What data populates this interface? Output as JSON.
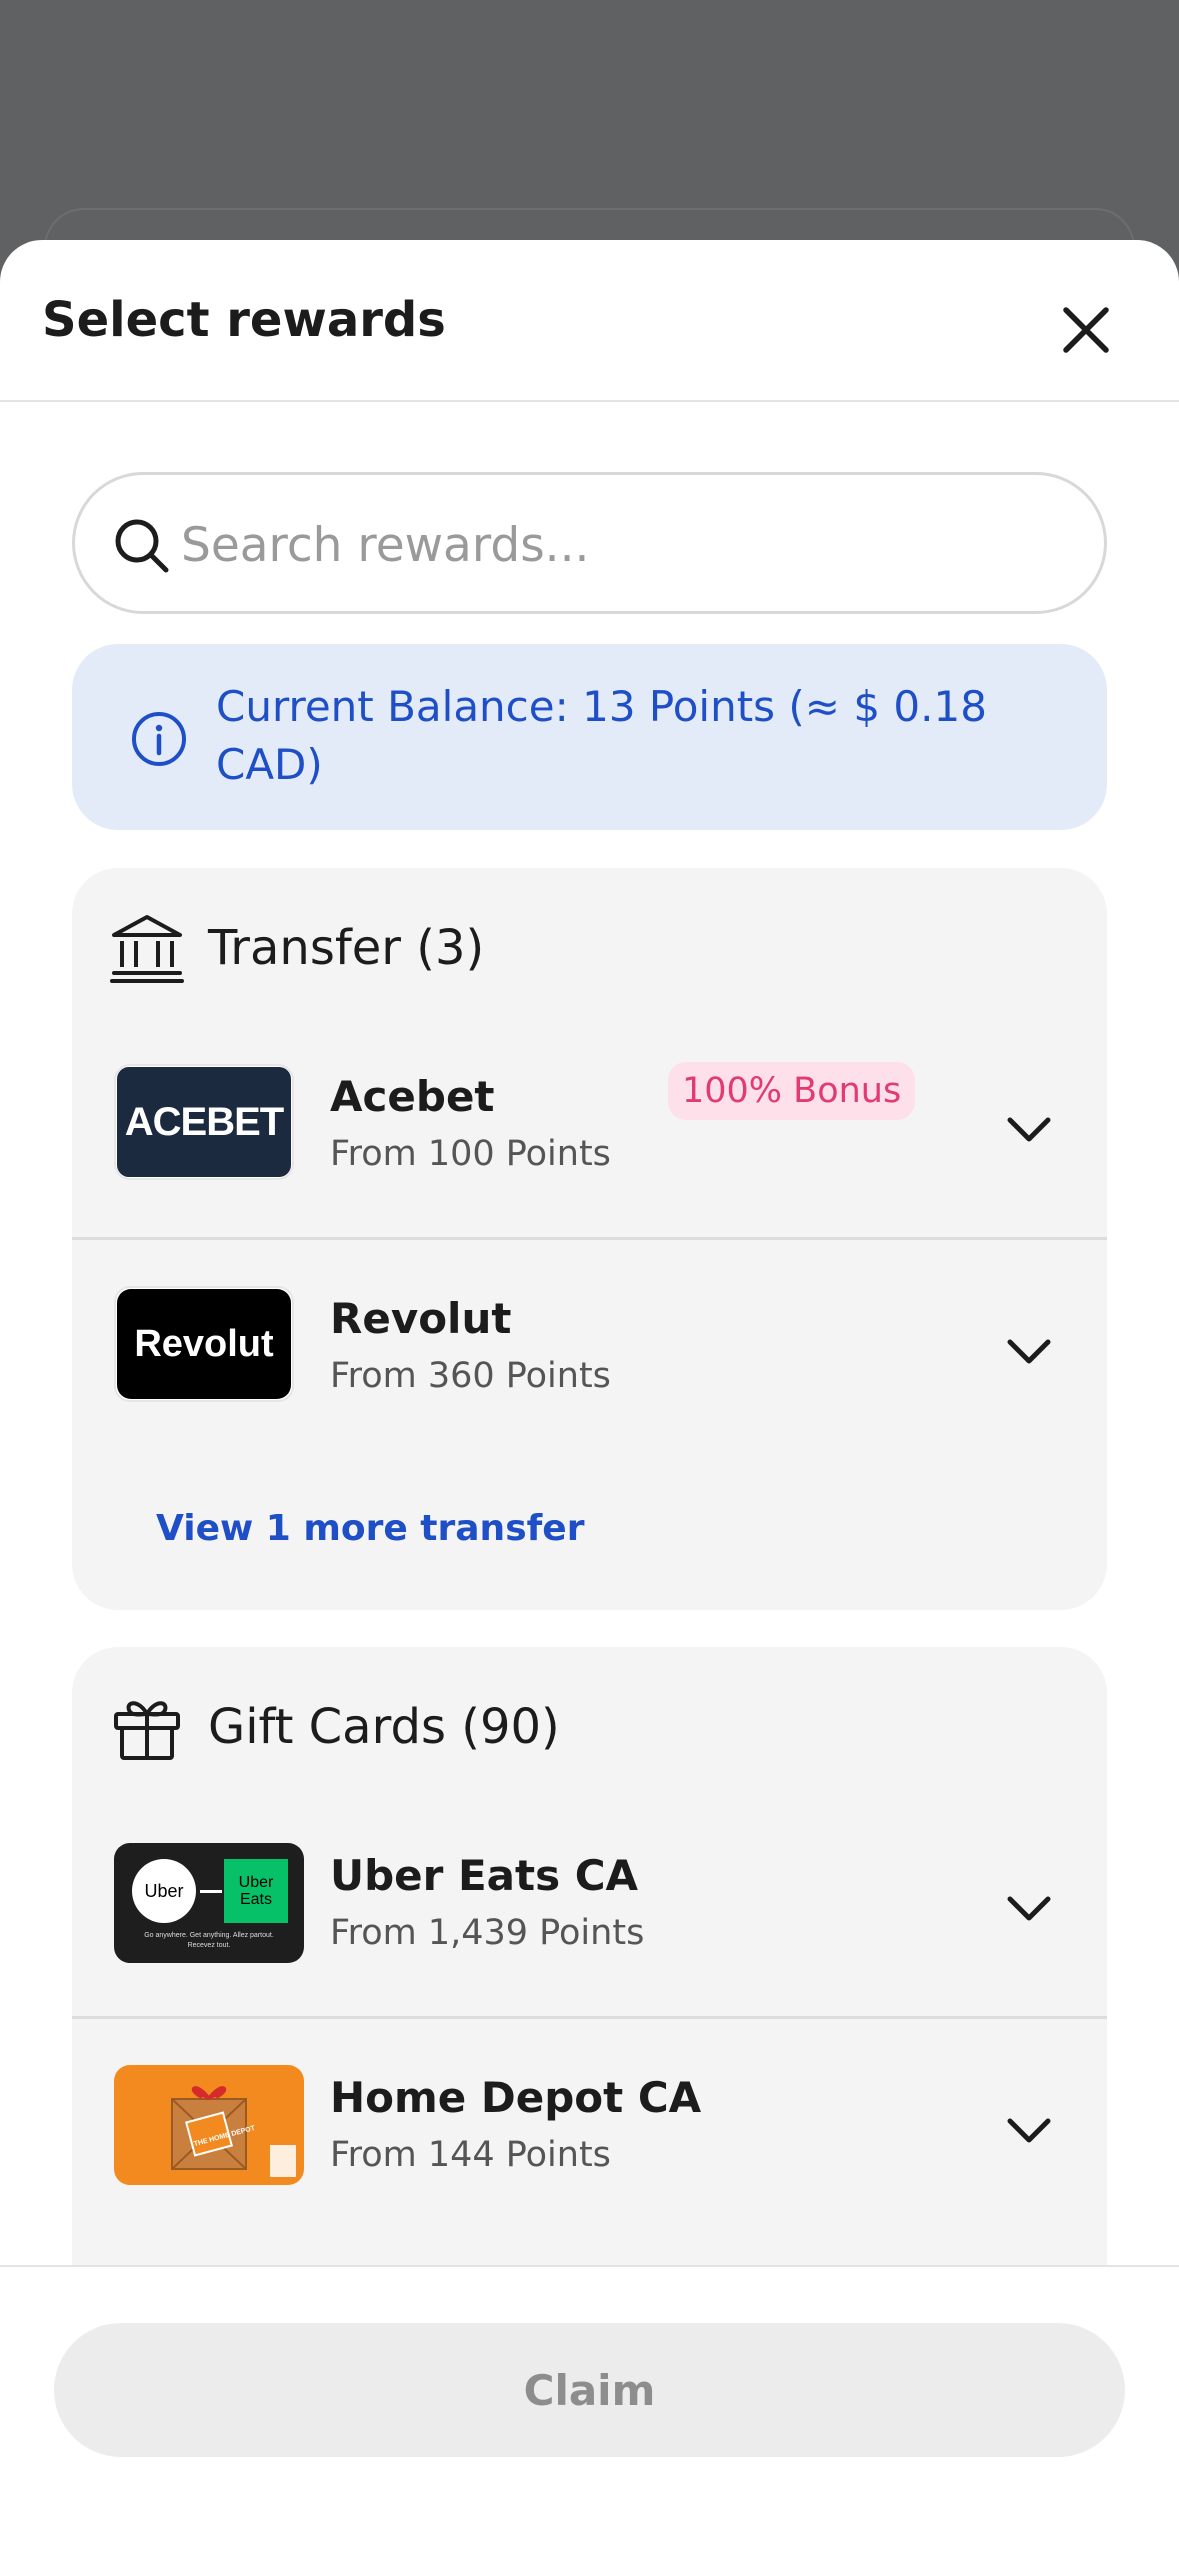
{
  "sheet": {
    "title": "Select rewards"
  },
  "search": {
    "placeholder": "Search rewards..."
  },
  "balance": {
    "text": "Current Balance: 13 Points (≈ $ 0.18 CAD)"
  },
  "transfer": {
    "title": "Transfer (3)",
    "items": [
      {
        "name": "Acebet",
        "sub": "From 100 Points",
        "badge": "100% Bonus",
        "logo_text": "ACEBET"
      },
      {
        "name": "Revolut",
        "sub": "From 360 Points",
        "logo_text": "Revolut"
      }
    ],
    "view_more": "View 1 more transfer"
  },
  "gift_cards": {
    "title": "Gift Cards (90)",
    "items": [
      {
        "name": "Uber Eats CA",
        "sub": "From 1,439 Points",
        "logo_text_1": "Uber",
        "logo_text_2": "Uber Eats",
        "logo_tagline": "Go anywhere. Get anything. Allez partout. Recevez tout."
      },
      {
        "name": "Home Depot CA",
        "sub": "From 144 Points",
        "logo_text": "THE HOME DEPOT"
      }
    ]
  },
  "footer": {
    "claim_label": "Claim"
  },
  "colors": {
    "accent": "#1f4fc7",
    "badge_text": "#e23a72",
    "badge_bg": "#fde0ea",
    "overlay": "#606163"
  }
}
